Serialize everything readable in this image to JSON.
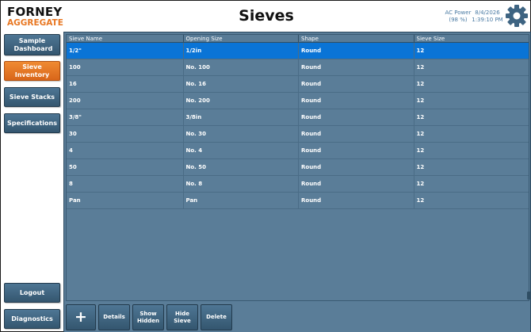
{
  "logo": {
    "line1": "FORNEY",
    "line2": "AGGREGATE"
  },
  "title": "Sieves",
  "status": {
    "power_label": "AC Power",
    "power_percent": "(98 %)",
    "date": "8/4/2026",
    "time": "1:39:10 PM"
  },
  "icons": {
    "settings": "gear-icon",
    "add": "plus-icon"
  },
  "sidebar": {
    "items": [
      {
        "label": "Sample Dashboard",
        "active": false
      },
      {
        "label": "Sieve Inventory",
        "active": true
      },
      {
        "label": "Sieve Stacks",
        "active": false
      },
      {
        "label": "Specifications",
        "active": false
      }
    ],
    "logout": "Logout",
    "diagnostics": "Diagnostics"
  },
  "table": {
    "columns": [
      "Sieve Name",
      "Opening Size",
      "Shape",
      "Sieve Size"
    ],
    "rows": [
      [
        "1/2\"",
        "1/2in",
        "Round",
        "12"
      ],
      [
        "100",
        "No. 100",
        "Round",
        "12"
      ],
      [
        "16",
        "No. 16",
        "Round",
        "12"
      ],
      [
        "200",
        "No. 200",
        "Round",
        "12"
      ],
      [
        "3/8\"",
        "3/8in",
        "Round",
        "12"
      ],
      [
        "30",
        "No. 30",
        "Round",
        "12"
      ],
      [
        "4",
        "No. 4",
        "Round",
        "12"
      ],
      [
        "50",
        "No. 50",
        "Round",
        "12"
      ],
      [
        "8",
        "No. 8",
        "Round",
        "12"
      ],
      [
        "Pan",
        "Pan",
        "Round",
        "12"
      ]
    ],
    "selected_index": 0
  },
  "toolbar": {
    "add": "+",
    "details": "Details",
    "show_hidden": "Show Hidden",
    "hide_sieve": "Hide Sieve",
    "delete": "Delete"
  },
  "colors": {
    "accent_orange": "#e87722",
    "selected_row": "#0a74d6",
    "panel": "#5a7d98",
    "button": "#3f6580"
  }
}
